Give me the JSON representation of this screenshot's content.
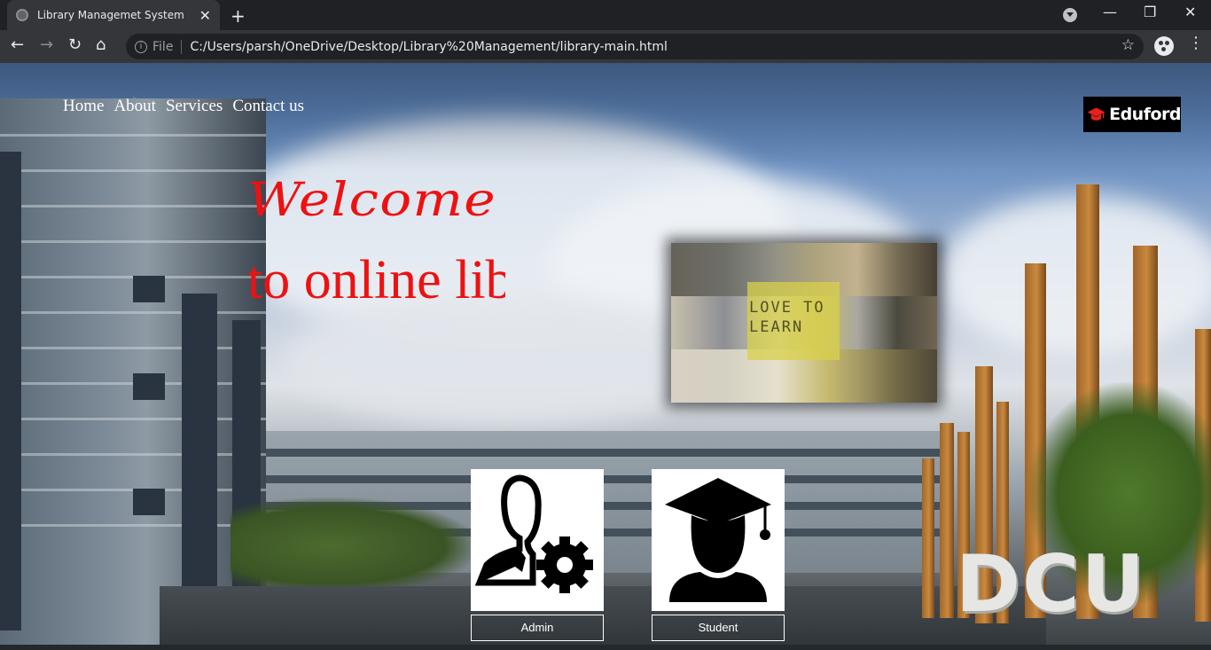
{
  "browser": {
    "tab_title": "Library Managemet System",
    "tab_close": "✕",
    "new_tab": "+",
    "url_scheme": "File",
    "url": "C:/Users/parsh/OneDrive/Desktop/Library%20Management/library-main.html"
  },
  "nav": {
    "items": [
      "Home",
      "About",
      "Services",
      "Contact us"
    ]
  },
  "logo": {
    "text": "Eduford"
  },
  "hero": {
    "welcome": "Welcome",
    "headline": "to online library"
  },
  "photo": {
    "sign_text": "LOVE TO LEARN"
  },
  "cards": {
    "admin_label": "Admin",
    "student_label": "Student"
  },
  "background": {
    "sign_text": "DCU"
  },
  "colors": {
    "accent_red": "#ee1111",
    "logo_bg": "#000000",
    "chrome_bg": "#202124"
  }
}
